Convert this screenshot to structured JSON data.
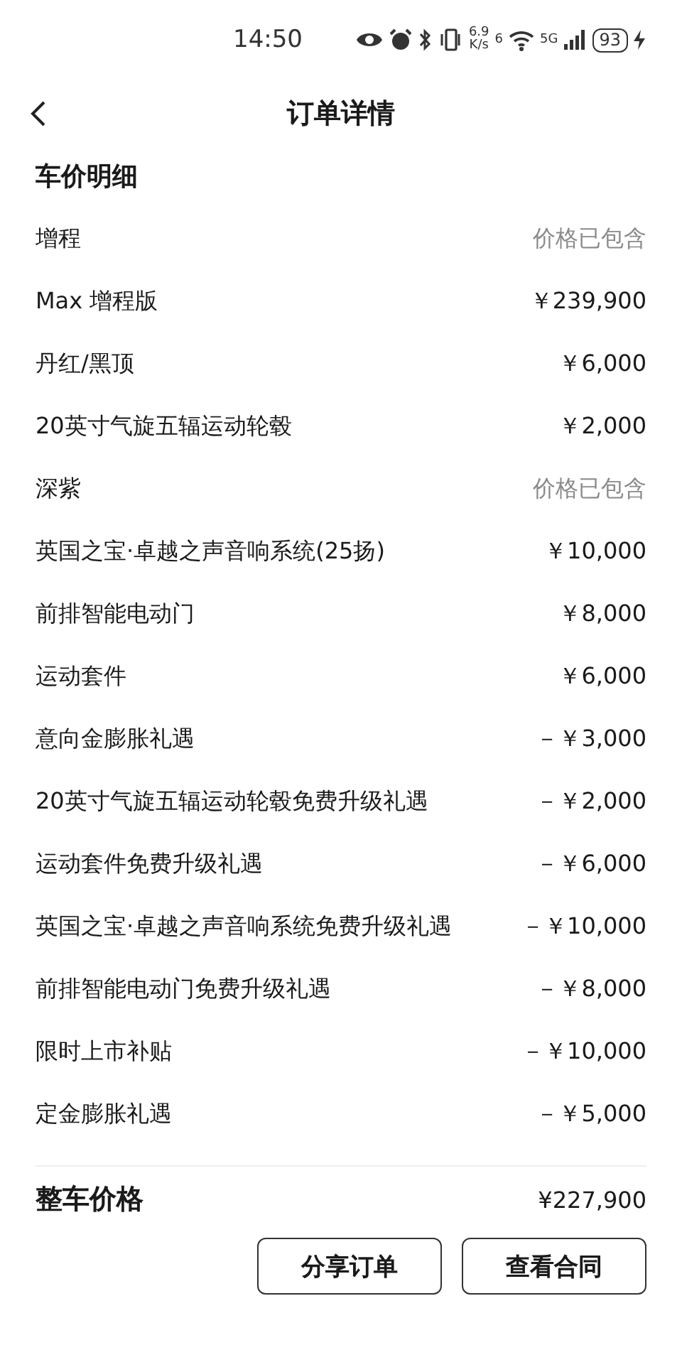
{
  "status_bar": {
    "time": "14:50",
    "speed_value": "6.9",
    "speed_unit": "K/s",
    "wifi_badge": "6",
    "network": "5G",
    "battery": "93"
  },
  "header": {
    "title": "订单详情"
  },
  "section": {
    "title": "车价明细"
  },
  "items": [
    {
      "label": "增程",
      "amount": "价格已包含",
      "kind": "included"
    },
    {
      "label": "Max 增程版",
      "amount": "￥239,900",
      "kind": "price"
    },
    {
      "label": "丹红/黑顶",
      "amount": "￥6,000",
      "kind": "price"
    },
    {
      "label": "20英寸气旋五辐运动轮毂",
      "amount": "￥2,000",
      "kind": "price"
    },
    {
      "label": "深紫",
      "amount": "价格已包含",
      "kind": "included"
    },
    {
      "label": "英国之宝·卓越之声音响系统(25扬)",
      "amount": "￥10,000",
      "kind": "price"
    },
    {
      "label": "前排智能电动门",
      "amount": "￥8,000",
      "kind": "price"
    },
    {
      "label": "运动套件",
      "amount": "￥6,000",
      "kind": "price"
    },
    {
      "label": "意向金膨胀礼遇",
      "amount": "－￥3,000",
      "kind": "discount"
    },
    {
      "label": "20英寸气旋五辐运动轮毂免费升级礼遇",
      "amount": "－￥2,000",
      "kind": "discount"
    },
    {
      "label": "运动套件免费升级礼遇",
      "amount": "－￥6,000",
      "kind": "discount"
    },
    {
      "label": "英国之宝·卓越之声音响系统免费升级礼遇",
      "amount": "－￥10,000",
      "kind": "discount"
    },
    {
      "label": "前排智能电动门免费升级礼遇",
      "amount": "－￥8,000",
      "kind": "discount"
    },
    {
      "label": "限时上市补贴",
      "amount": "－￥10,000",
      "kind": "discount"
    },
    {
      "label": "定金膨胀礼遇",
      "amount": "－￥5,000",
      "kind": "discount"
    }
  ],
  "total": {
    "label": "整车价格",
    "amount": "¥227,900"
  },
  "buttons": [
    "分享订单",
    "查看合同"
  ]
}
